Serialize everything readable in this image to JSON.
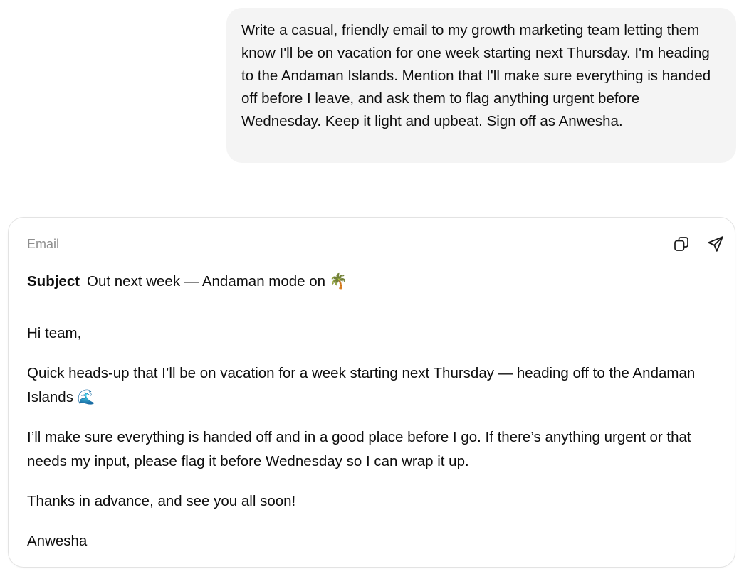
{
  "user_message": {
    "text": "Write a casual, friendly email to my growth marketing team letting them know I'll be on vacation for one week starting next Thursday. I'm heading to the Andaman Islands. Mention that I'll make sure everything is handed off before I leave, and ask them to flag anything urgent before Wednesday. Keep it light and upbeat. Sign off as Anwesha."
  },
  "email_card": {
    "label": "Email",
    "actions": [
      {
        "icon": "copy-icon"
      },
      {
        "icon": "send-icon"
      }
    ],
    "subject_label": "Subject",
    "subject": "Out next week — Andaman mode on 🌴",
    "body": {
      "greeting": "Hi team,",
      "paragraph_1": "Quick heads-up that I’ll be on vacation for a week starting next Thursday — heading off to the Andaman Islands 🌊",
      "paragraph_2": "I’ll make sure everything is handed off and in a good place before I go. If there’s anything urgent or that needs my input, please flag it before Wednesday so I can wrap it up.",
      "closing": "Thanks in advance, and see you all soon!",
      "signature": "Anwesha"
    }
  }
}
